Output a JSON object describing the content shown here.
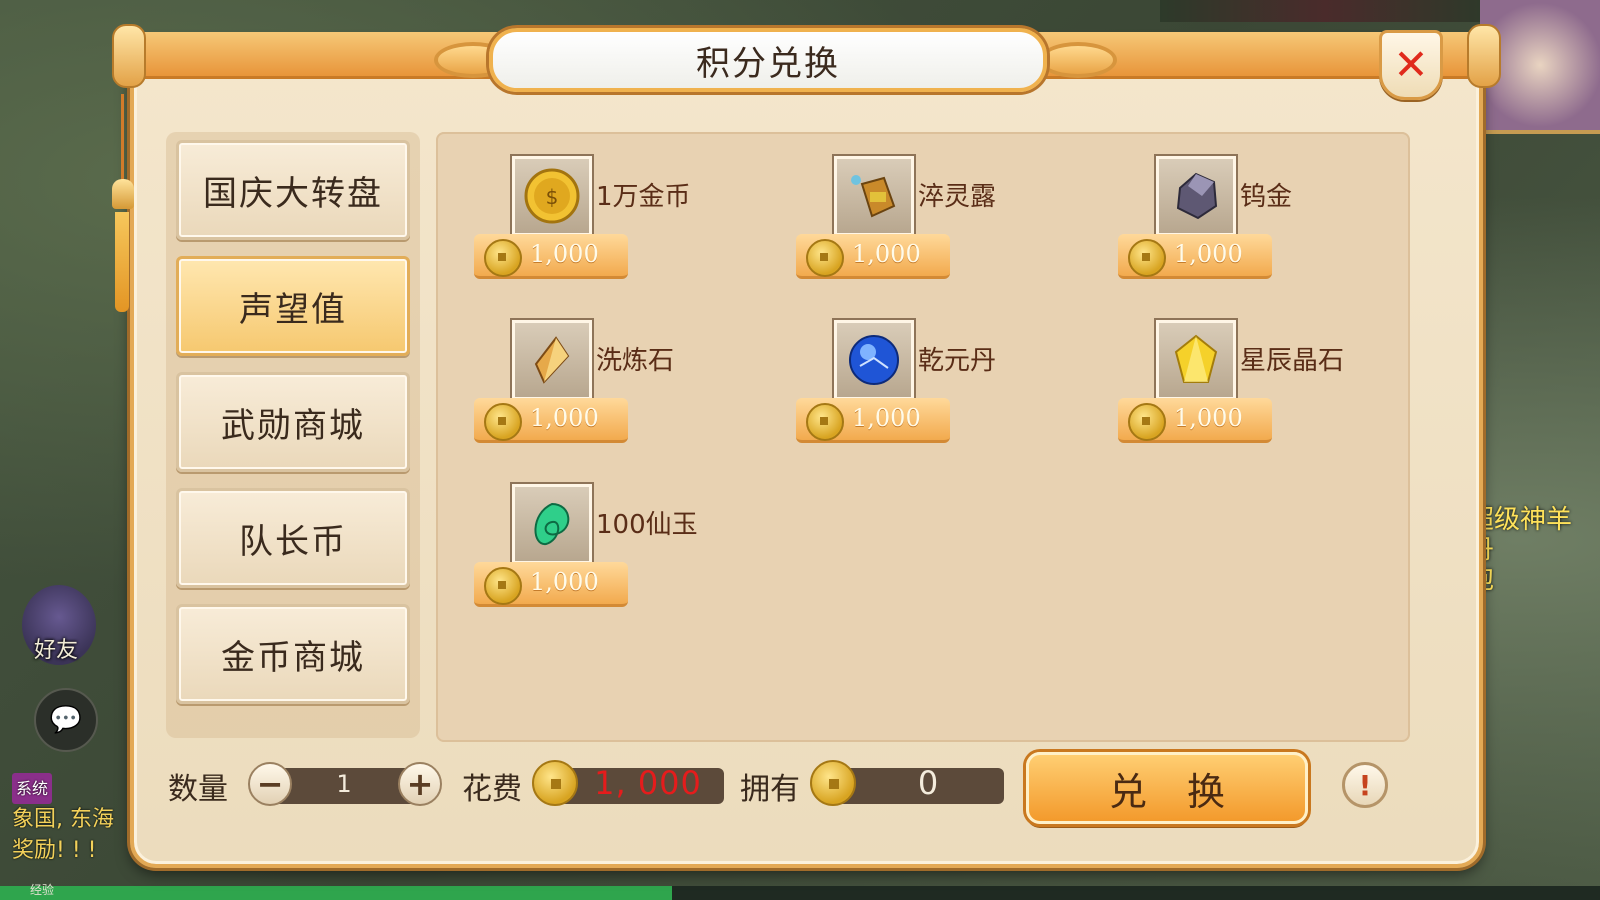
{
  "background": {
    "friend_label": "好友",
    "chat_lines": [
      "系统",
      "象国, 东海",
      "奖励! ! !"
    ],
    "right_text": [
      "超级神羊",
      "丹",
      "泡"
    ],
    "exp_label": "经验"
  },
  "dialog": {
    "title": "积分兑换",
    "close_icon": "close-icon"
  },
  "nav": {
    "items": [
      {
        "label": "国庆大转盘",
        "active": false
      },
      {
        "label": "声望值",
        "active": true
      },
      {
        "label": "武勋商城",
        "active": false
      },
      {
        "label": "队长币",
        "active": false
      },
      {
        "label": "金币商城",
        "active": false
      }
    ]
  },
  "items": [
    {
      "name": "1万金币",
      "price": "1,000",
      "icon": "gold-coin-icon"
    },
    {
      "name": "淬灵露",
      "price": "1,000",
      "icon": "potion-jar-icon"
    },
    {
      "name": "钨金",
      "price": "1,000",
      "icon": "tungsten-ore-icon"
    },
    {
      "name": "洗炼石",
      "price": "1,000",
      "icon": "refine-stone-icon"
    },
    {
      "name": "乾元丹",
      "price": "1,000",
      "icon": "blue-orb-icon"
    },
    {
      "name": "星辰晶石",
      "price": "1,000",
      "icon": "star-crystal-icon"
    },
    {
      "name": "100仙玉",
      "price": "1,000",
      "icon": "jade-icon"
    }
  ],
  "footer": {
    "quantity_label": "数量",
    "quantity_value": "1",
    "cost_label": "花费",
    "cost_value": "1, 000",
    "own_label": "拥有",
    "own_value": "0",
    "exchange_label": "兑换",
    "info_label": "!"
  },
  "colors": {
    "accent": "#f39a2c",
    "cost_text": "#e51c1c",
    "item_name": "#5a2d17"
  }
}
